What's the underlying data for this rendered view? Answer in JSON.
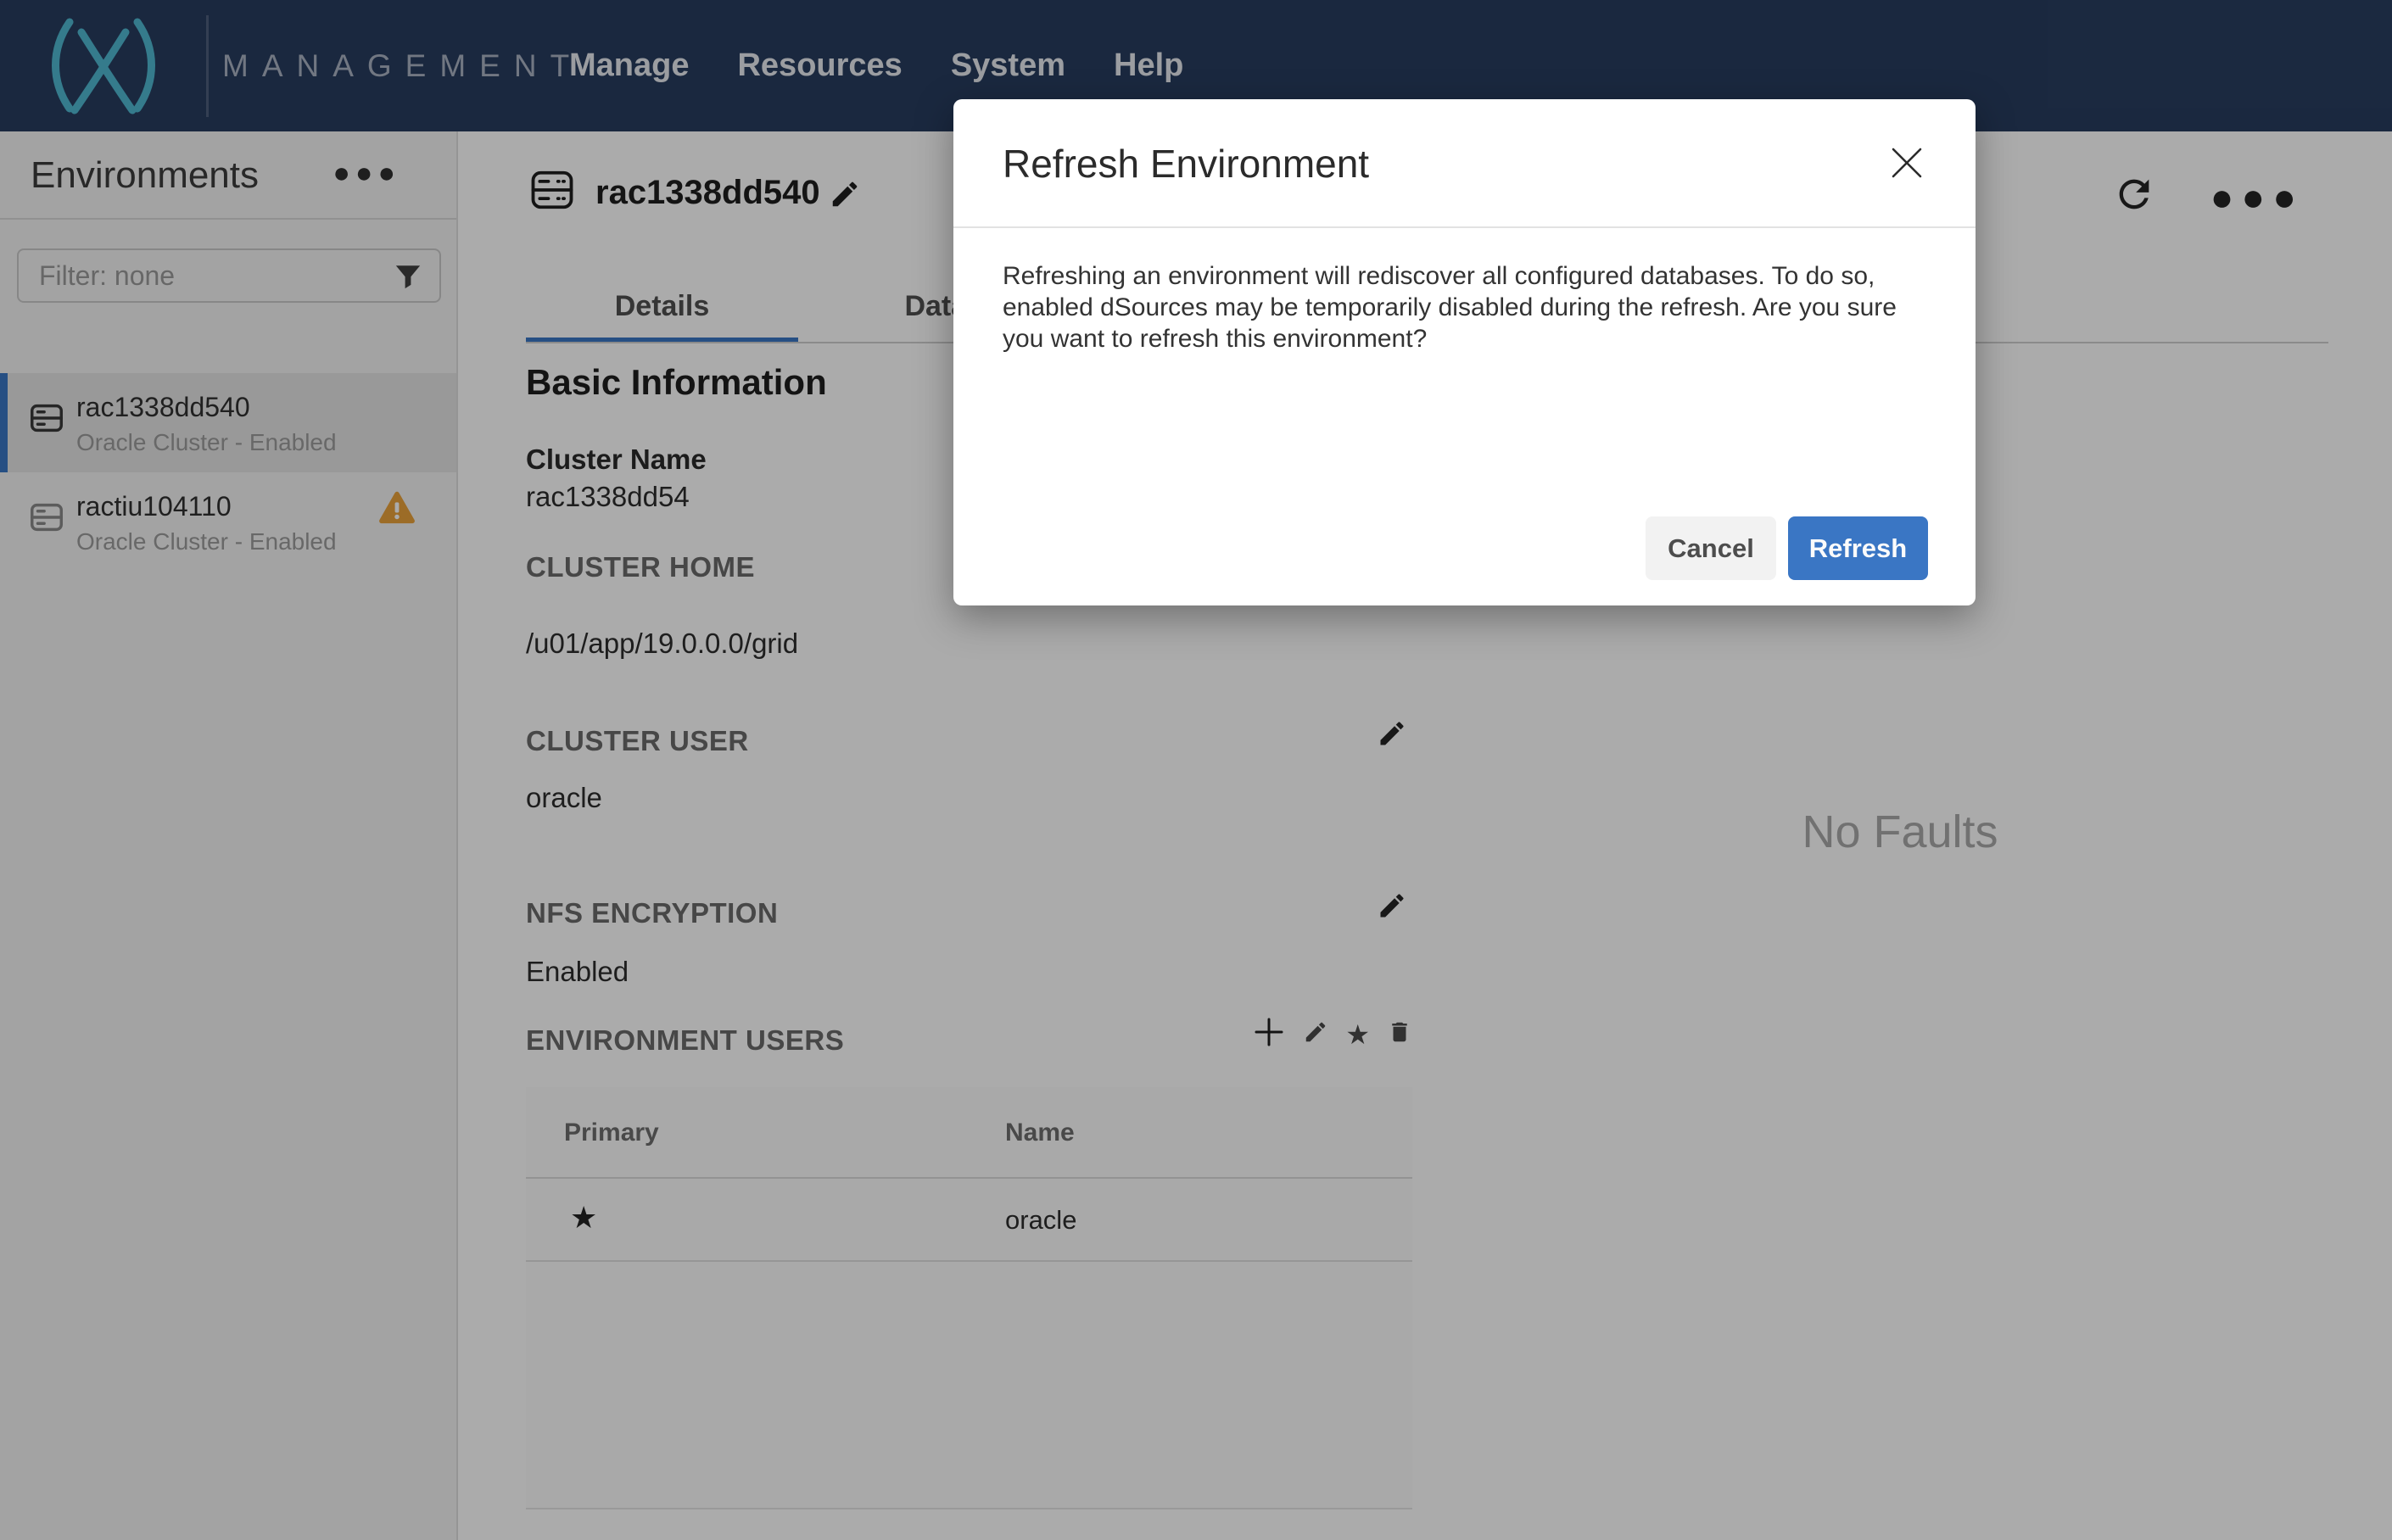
{
  "nav": {
    "brand": "MANAGEMENT",
    "items": [
      {
        "label": "Manage"
      },
      {
        "label": "Resources"
      },
      {
        "label": "System"
      },
      {
        "label": "Help"
      }
    ]
  },
  "sidebar": {
    "title": "Environments",
    "filter": {
      "placeholder": "Filter: none"
    },
    "items": [
      {
        "name": "rac1338dd540",
        "status": "Oracle Cluster - Enabled",
        "selected": true,
        "warning": false
      },
      {
        "name": "ractiu104110",
        "status": "Oracle Cluster - Enabled",
        "selected": false,
        "warning": true
      }
    ]
  },
  "header": {
    "title": "rac1338dd540"
  },
  "tabs": [
    {
      "label": "Details",
      "active": true
    },
    {
      "label": "Databases",
      "active": false
    }
  ],
  "details": {
    "section_title": "Basic Information",
    "cluster_name_label": "Cluster Name",
    "cluster_name_value": "rac1338dd54",
    "cluster_home_label": "CLUSTER HOME",
    "cluster_home_value": "/u01/app/19.0.0.0/grid",
    "cluster_user_label": "CLUSTER USER",
    "cluster_user_value": "oracle",
    "nfs_label": "NFS ENCRYPTION",
    "nfs_value": "Enabled",
    "env_users_label": "ENVIRONMENT USERS"
  },
  "env_users_table": {
    "columns": [
      "Primary",
      "Name"
    ],
    "rows": [
      {
        "primary": true,
        "name": "oracle"
      }
    ]
  },
  "faults": {
    "empty_text": "No Faults"
  },
  "modal": {
    "title": "Refresh Environment",
    "body": "Refreshing an environment will rediscover all configured databases. To do so, enabled dSources may be temporarily disabled during the refresh. Are you sure you want to refresh this environment?",
    "cancel_label": "Cancel",
    "confirm_label": "Refresh"
  },
  "colors": {
    "accent_blue": "#3A76C4",
    "warning_orange": "#E9A13B",
    "nav_bg": "#283D5F"
  }
}
